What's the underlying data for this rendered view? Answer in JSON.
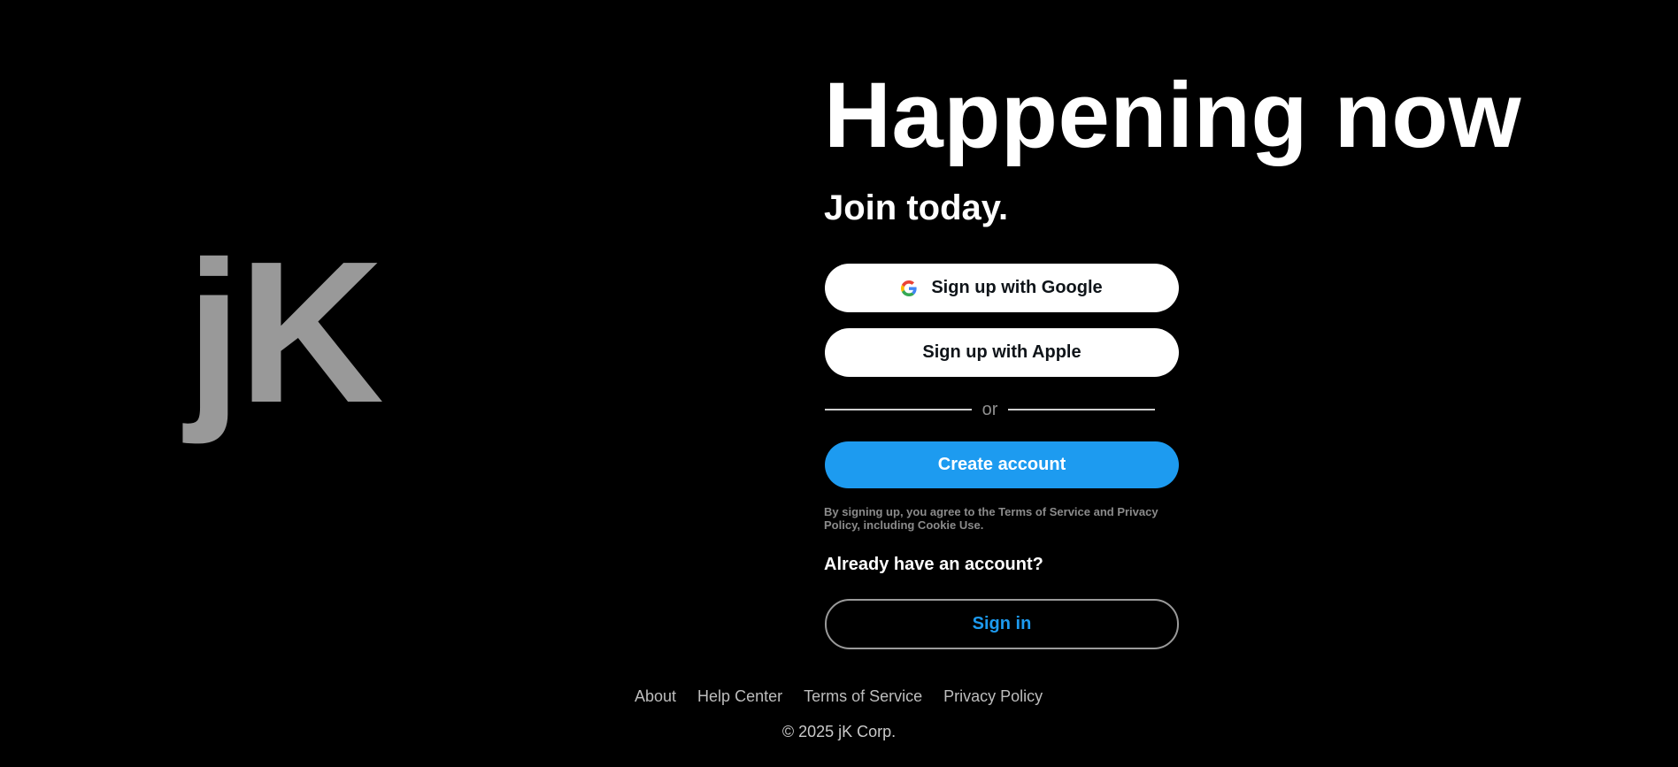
{
  "logo": {
    "text": "jK"
  },
  "hero": {
    "headline": "Happening now",
    "subheadline": "Join today."
  },
  "signup": {
    "google_label": "Sign up with Google",
    "apple_label": "Sign up with Apple",
    "divider_text": "or",
    "create_label": "Create account",
    "legal_text": "By signing up, you agree to the Terms of Service and Privacy Policy, including Cookie Use."
  },
  "signin": {
    "prompt": "Already have an account?",
    "button_label": "Sign in"
  },
  "footer": {
    "links": [
      "About",
      "Help Center",
      "Terms of Service",
      "Privacy Policy"
    ],
    "copyright": "© 2025 jK Corp."
  },
  "colors": {
    "background": "#000000",
    "accent": "#1d9bf0",
    "logo": "#999999"
  },
  "icons": {
    "google": "google-icon"
  }
}
